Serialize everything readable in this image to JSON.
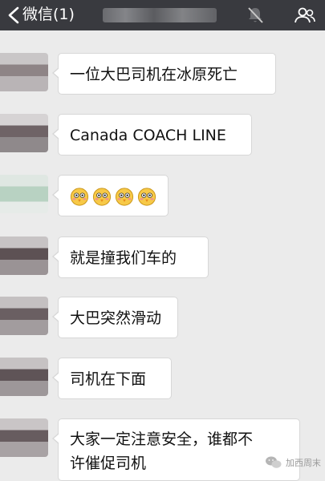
{
  "header": {
    "back_label": "微信(1)",
    "colors": {
      "bar": "#393a3f",
      "text": "#ffffff"
    }
  },
  "messages": [
    {
      "text": "一位大巴司机在冰原死亡"
    },
    {
      "text": "Canada COACH LINE"
    },
    {
      "emoji": [
        "flushed-chick-emoji",
        "flushed-chick-emoji",
        "flushed-chick-emoji",
        "flushed-chick-emoji"
      ]
    },
    {
      "text": "就是撞我们车的"
    },
    {
      "text": "大巴突然滑动"
    },
    {
      "text": "司机在下面"
    },
    {
      "line1": "大家一定注意安全，谁都不",
      "line2": "许催促司机"
    }
  ],
  "watermark": {
    "text": "加西周末"
  }
}
